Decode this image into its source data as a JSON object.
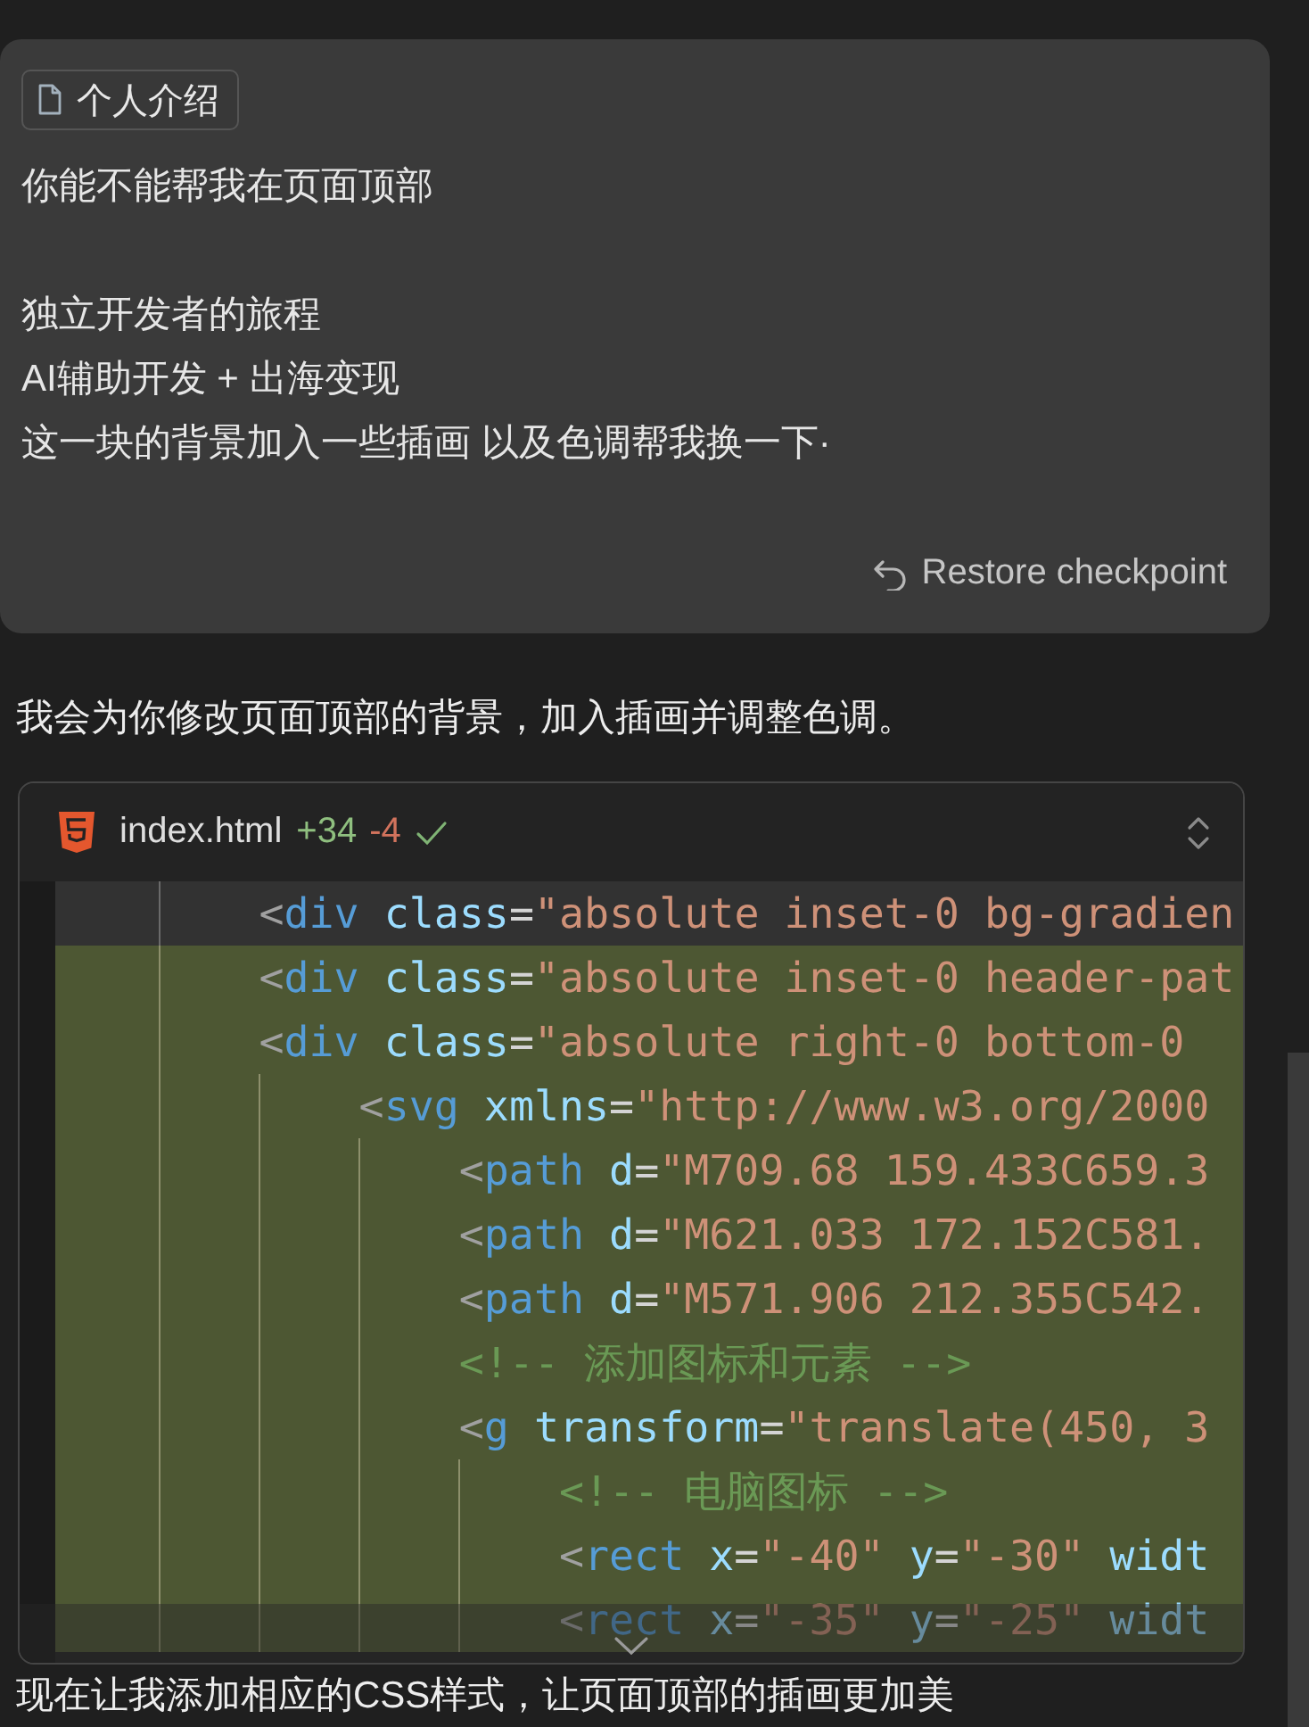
{
  "user_message": {
    "attachment": {
      "label": "个人介绍"
    },
    "paragraphs": [
      [
        "你能不能帮我在页面顶部"
      ],
      [
        "独立开发者的旅程",
        "AI辅助开发 + 出海变现",
        "这一块的背景加入一些插画 以及色调帮我换一下·"
      ]
    ],
    "restore_button": {
      "label": "Restore checkpoint"
    }
  },
  "assistant_text": "我会为你修改页面顶部的背景，加入插画并调整色调。",
  "code_block": {
    "filename": "index.html",
    "additions": "+34",
    "deletions": "-4",
    "applied": true,
    "lines": [
      {
        "added": false,
        "tokens": [
          {
            "kind": "punct",
            "text": "<"
          },
          {
            "kind": "tag",
            "text": "div"
          },
          {
            "kind": "attr",
            "text": " class"
          },
          {
            "kind": "eq",
            "text": "="
          },
          {
            "kind": "string",
            "text": "\"absolute inset-0 bg-gradien"
          }
        ]
      },
      {
        "added": true,
        "tokens": [
          {
            "kind": "punct",
            "text": "<"
          },
          {
            "kind": "tag",
            "text": "div"
          },
          {
            "kind": "attr",
            "text": " class"
          },
          {
            "kind": "eq",
            "text": "="
          },
          {
            "kind": "string",
            "text": "\"absolute inset-0 header-pat"
          }
        ]
      },
      {
        "added": true,
        "tokens": [
          {
            "kind": "punct",
            "text": "<"
          },
          {
            "kind": "tag",
            "text": "div"
          },
          {
            "kind": "attr",
            "text": " class"
          },
          {
            "kind": "eq",
            "text": "="
          },
          {
            "kind": "string",
            "text": "\"absolute right-0 bottom-0"
          }
        ],
        "children": [
          {
            "added": true,
            "tokens": [
              {
                "kind": "punct",
                "text": "<"
              },
              {
                "kind": "tag",
                "text": "svg"
              },
              {
                "kind": "attr",
                "text": " xmlns"
              },
              {
                "kind": "eq",
                "text": "="
              },
              {
                "kind": "string",
                "text": "\"http://www.w3.org/2000"
              }
            ],
            "children": [
              {
                "added": true,
                "tokens": [
                  {
                    "kind": "punct",
                    "text": "<"
                  },
                  {
                    "kind": "tag",
                    "text": "path"
                  },
                  {
                    "kind": "attr",
                    "text": " d"
                  },
                  {
                    "kind": "eq",
                    "text": "="
                  },
                  {
                    "kind": "string",
                    "text": "\"M709.68 159.433C659.3"
                  }
                ]
              },
              {
                "added": true,
                "tokens": [
                  {
                    "kind": "punct",
                    "text": "<"
                  },
                  {
                    "kind": "tag",
                    "text": "path"
                  },
                  {
                    "kind": "attr",
                    "text": " d"
                  },
                  {
                    "kind": "eq",
                    "text": "="
                  },
                  {
                    "kind": "string",
                    "text": "\"M621.033 172.152C581."
                  }
                ]
              },
              {
                "added": true,
                "tokens": [
                  {
                    "kind": "punct",
                    "text": "<"
                  },
                  {
                    "kind": "tag",
                    "text": "path"
                  },
                  {
                    "kind": "attr",
                    "text": " d"
                  },
                  {
                    "kind": "eq",
                    "text": "="
                  },
                  {
                    "kind": "string",
                    "text": "\"M571.906 212.355C542."
                  }
                ]
              },
              {
                "added": true,
                "tokens": [
                  {
                    "kind": "comment",
                    "text": "<!-- 添加图标和元素 -->"
                  }
                ]
              },
              {
                "added": true,
                "tokens": [
                  {
                    "kind": "punct",
                    "text": "<"
                  },
                  {
                    "kind": "tag",
                    "text": "g"
                  },
                  {
                    "kind": "attr",
                    "text": " transform"
                  },
                  {
                    "kind": "eq",
                    "text": "="
                  },
                  {
                    "kind": "string",
                    "text": "\"translate(450, 3"
                  }
                ],
                "children": [
                  {
                    "added": true,
                    "tokens": [
                      {
                        "kind": "comment",
                        "text": "<!-- 电脑图标 -->"
                      }
                    ]
                  },
                  {
                    "added": true,
                    "tokens": [
                      {
                        "kind": "punct",
                        "text": "<"
                      },
                      {
                        "kind": "tag",
                        "text": "rect"
                      },
                      {
                        "kind": "attr",
                        "text": " x"
                      },
                      {
                        "kind": "eq",
                        "text": "="
                      },
                      {
                        "kind": "string",
                        "text": "\"-40\""
                      },
                      {
                        "kind": "attr",
                        "text": " y"
                      },
                      {
                        "kind": "eq",
                        "text": "="
                      },
                      {
                        "kind": "string",
                        "text": "\"-30\""
                      },
                      {
                        "kind": "attr",
                        "text": " widt"
                      }
                    ]
                  },
                  {
                    "added": true,
                    "tokens": [
                      {
                        "kind": "punct",
                        "text": "<"
                      },
                      {
                        "kind": "tag",
                        "text": "rect"
                      },
                      {
                        "kind": "attr",
                        "text": " x"
                      },
                      {
                        "kind": "eq",
                        "text": "="
                      },
                      {
                        "kind": "string",
                        "text": "\"-35\""
                      },
                      {
                        "kind": "attr",
                        "text": " y"
                      },
                      {
                        "kind": "eq",
                        "text": "="
                      },
                      {
                        "kind": "string",
                        "text": "\"-25\""
                      },
                      {
                        "kind": "attr",
                        "text": " widt"
                      }
                    ]
                  }
                ]
              }
            ]
          }
        ]
      }
    ]
  },
  "trailing_text": "现在让我添加相应的CSS样式，让页面顶部的插画更加美"
}
